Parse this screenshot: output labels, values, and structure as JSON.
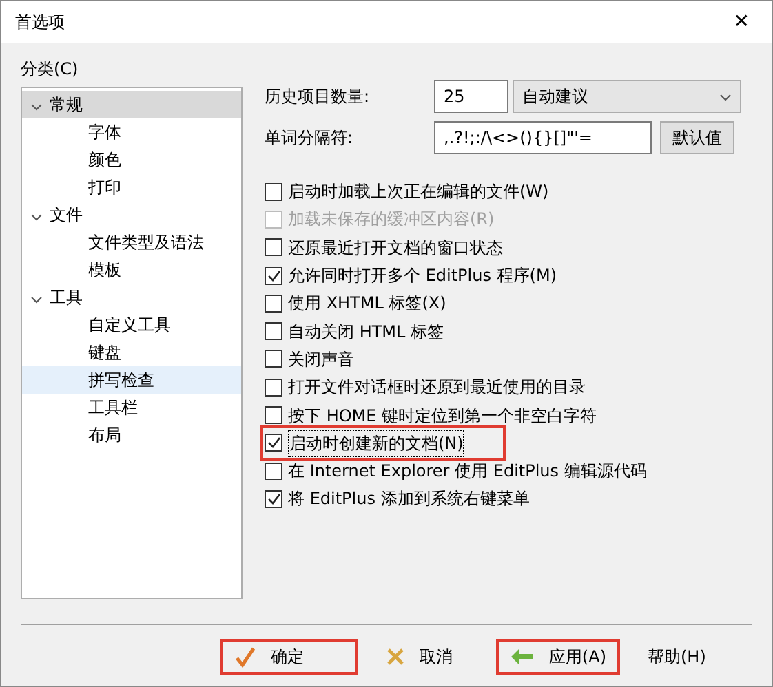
{
  "window": {
    "title": "首选项",
    "close": "✕"
  },
  "category_label": "分类(C)",
  "tree": [
    {
      "label": "常规",
      "expanded": true,
      "selected": true,
      "children": [
        {
          "label": "字体",
          "selected": false
        },
        {
          "label": "颜色",
          "selected": false
        },
        {
          "label": "打印",
          "selected": false
        }
      ]
    },
    {
      "label": "文件",
      "expanded": true,
      "selected": false,
      "children": [
        {
          "label": "文件类型及语法",
          "selected": false
        },
        {
          "label": "模板",
          "selected": false
        }
      ]
    },
    {
      "label": "工具",
      "expanded": true,
      "selected": false,
      "children": [
        {
          "label": "自定义工具",
          "selected": false
        },
        {
          "label": "键盘",
          "selected": false
        },
        {
          "label": "拼写检查",
          "selected": false,
          "hovered": true
        },
        {
          "label": "工具栏",
          "selected": false
        },
        {
          "label": "布局",
          "selected": false
        }
      ]
    }
  ],
  "history": {
    "label": "历史项目数量:",
    "value": "25",
    "dropdown": "自动建议"
  },
  "delimiters": {
    "label": "单词分隔符:",
    "value": ",.?!;:/\\<>(){}[]\"'=",
    "button": "默认值"
  },
  "options": [
    {
      "label": "启动时加载上次正在编辑的文件(W)",
      "checked": false,
      "disabled": false,
      "highlighted": false
    },
    {
      "label": "加载未保存的缓冲区内容(R)",
      "checked": false,
      "disabled": true,
      "highlighted": false
    },
    {
      "label": "还原最近打开文档的窗口状态",
      "checked": false,
      "disabled": false,
      "highlighted": false
    },
    {
      "label": "允许同时打开多个 EditPlus 程序(M)",
      "checked": true,
      "disabled": false,
      "highlighted": false
    },
    {
      "label": "使用 XHTML 标签(X)",
      "checked": false,
      "disabled": false,
      "highlighted": false
    },
    {
      "label": "自动关闭 HTML 标签",
      "checked": false,
      "disabled": false,
      "highlighted": false
    },
    {
      "label": "关闭声音",
      "checked": false,
      "disabled": false,
      "highlighted": false
    },
    {
      "label": "打开文件对话框时还原到最近使用的目录",
      "checked": false,
      "disabled": false,
      "highlighted": false
    },
    {
      "label": "按下 HOME 键时定位到第一个非空白字符",
      "checked": false,
      "disabled": false,
      "highlighted": false
    },
    {
      "label": "启动时创建新的文档(N)",
      "checked": true,
      "disabled": false,
      "highlighted": true
    },
    {
      "label": "在 Internet Explorer 使用 EditPlus 编辑源代码",
      "checked": false,
      "disabled": false,
      "highlighted": false
    },
    {
      "label": "将 EditPlus 添加到系统右键菜单",
      "checked": true,
      "disabled": false,
      "highlighted": false
    }
  ],
  "buttons": [
    {
      "kind": "ok",
      "label": "确定",
      "highlighted": true
    },
    {
      "kind": "cancel",
      "label": "取消",
      "highlighted": false
    },
    {
      "kind": "apply",
      "label": "应用(A)",
      "highlighted": true
    },
    {
      "kind": "help",
      "label": "帮助(H)",
      "highlighted": false
    }
  ]
}
